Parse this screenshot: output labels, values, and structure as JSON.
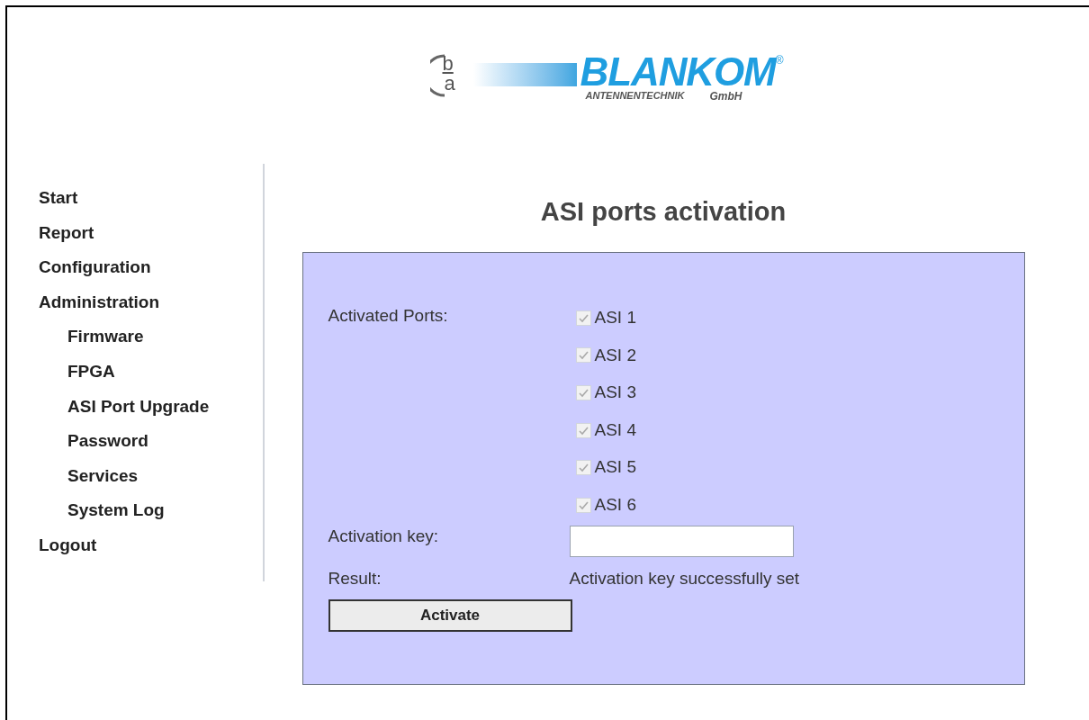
{
  "logo": {
    "mark_top": "b",
    "mark_bottom": "a",
    "name": "BLANKOM",
    "registered": "®",
    "subtitle": "ANTENNENTECHNIK",
    "suffix": "GmbH"
  },
  "nav": [
    {
      "label": "Start"
    },
    {
      "label": "Report"
    },
    {
      "label": "Configuration"
    },
    {
      "label": "Administration",
      "children": [
        {
          "label": "Firmware"
        },
        {
          "label": "FPGA"
        },
        {
          "label": "ASI Port Upgrade"
        },
        {
          "label": "Password"
        },
        {
          "label": "Services"
        },
        {
          "label": "System Log"
        }
      ]
    },
    {
      "label": "Logout"
    }
  ],
  "heading": "ASI ports activation",
  "form": {
    "ports_label": "Activated Ports:",
    "ports": [
      {
        "label": "ASI 1",
        "checked": true,
        "disabled": true
      },
      {
        "label": "ASI 2",
        "checked": true,
        "disabled": true
      },
      {
        "label": "ASI 3",
        "checked": true,
        "disabled": true
      },
      {
        "label": "ASI 4",
        "checked": true,
        "disabled": true
      },
      {
        "label": "ASI 5",
        "checked": true,
        "disabled": true
      },
      {
        "label": "ASI 6",
        "checked": true,
        "disabled": true
      }
    ],
    "key_label": "Activation key:",
    "result_label": "Result:",
    "result": "Activation key successfully set",
    "button": "Activate"
  }
}
